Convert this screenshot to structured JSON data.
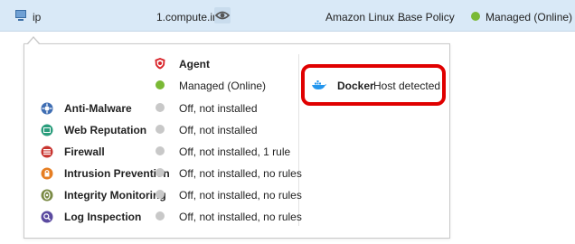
{
  "row": {
    "host_name": "ip",
    "address": "1.compute.inte",
    "os": "Amazon Linux ...",
    "policy": "Base Policy",
    "status": "Managed (Online)"
  },
  "agent": {
    "label": "Agent",
    "status": "Managed (Online)"
  },
  "modules": [
    {
      "name": "Anti-Malware",
      "status": "Off, not installed",
      "icon": "anti-malware-icon"
    },
    {
      "name": "Web Reputation",
      "status": "Off, not installed",
      "icon": "web-reputation-icon"
    },
    {
      "name": "Firewall",
      "status": "Off, not installed, 1 rule",
      "icon": "firewall-icon"
    },
    {
      "name": "Intrusion Prevention",
      "status": "Off, not installed, no rules",
      "icon": "intrusion-prevention-icon"
    },
    {
      "name": "Integrity Monitoring",
      "status": "Off, not installed, no rules",
      "icon": "integrity-monitoring-icon"
    },
    {
      "name": "Log Inspection",
      "status": "Off, not installed, no rules",
      "icon": "log-inspection-icon"
    }
  ],
  "docker": {
    "label": "Docker",
    "status": "Host detected"
  },
  "colors": {
    "row_highlight": "#d9e9f7",
    "online_green": "#7ab935",
    "inactive_gray": "#c8c8c8",
    "highlight_red": "#e00000",
    "docker_blue": "#2496ed"
  }
}
